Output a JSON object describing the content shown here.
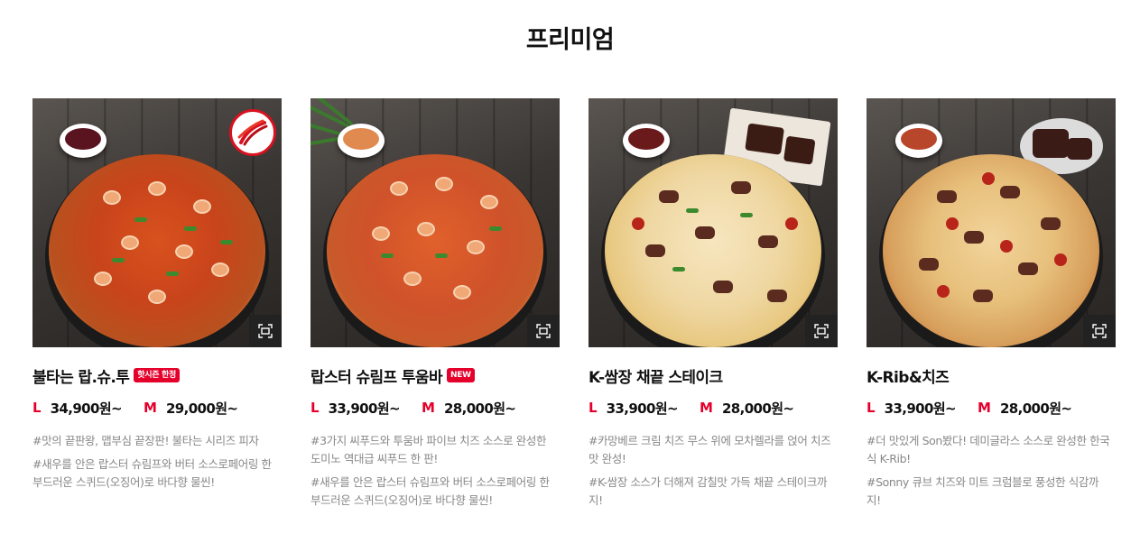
{
  "section": {
    "title": "프리미엄"
  },
  "products": [
    {
      "name": "불타는 랍.슈.투",
      "badge": "핫시즌 한정",
      "price_l_label": "L",
      "price_l": "34,900원~",
      "price_m_label": "M",
      "price_m": "29,000원~",
      "desc": [
        "#맛의 끝판왕, 맵부심 끝장판! 불타는 시리즈 피자",
        "#새우를 안은 랍스터 슈림프와 버터 소스로페어링 한 부드러운 스퀴드(오징어)로 바다향 물씬!"
      ]
    },
    {
      "name": "랍스터 슈림프 투움바",
      "badge": "NEW",
      "price_l_label": "L",
      "price_l": "33,900원~",
      "price_m_label": "M",
      "price_m": "28,000원~",
      "desc": [
        "#3가지 씨푸드와 투움바 파이브 치즈 소스로 완성한 도미노 역대급 씨푸드 한 판!",
        "#새우를 안은 랍스터 슈림프와 버터 소스로페어링 한 부드러운 스퀴드(오징어)로 바다향 물씬!"
      ]
    },
    {
      "name": "K-쌈장 채끝 스테이크",
      "badge": "",
      "price_l_label": "L",
      "price_l": "33,900원~",
      "price_m_label": "M",
      "price_m": "28,000원~",
      "desc": [
        "#카망베르 크림 치즈 무스 위에 모차렐라를 얹어 치즈맛 완성!",
        "#K-쌈장 소스가 더해져 감칠맛 가득 채끝 스테이크까지!"
      ]
    },
    {
      "name": "K-Rib&치즈",
      "badge": "",
      "price_l_label": "L",
      "price_l": "33,900원~",
      "price_m_label": "M",
      "price_m": "28,000원~",
      "desc": [
        "#더 맛있게 Son봤다! 데미글라스 소스로 완성한 한국식 K-Rib!",
        "#Sonny 큐브 치즈와 미트 크럼블로 풍성한 식감까지!"
      ]
    }
  ],
  "colors": {
    "accent": "#e4002b",
    "text": "#111111",
    "muted": "#888888"
  },
  "icons": {
    "zoom": "expand-frame-icon",
    "spicy": "chili-peppers-icon"
  }
}
